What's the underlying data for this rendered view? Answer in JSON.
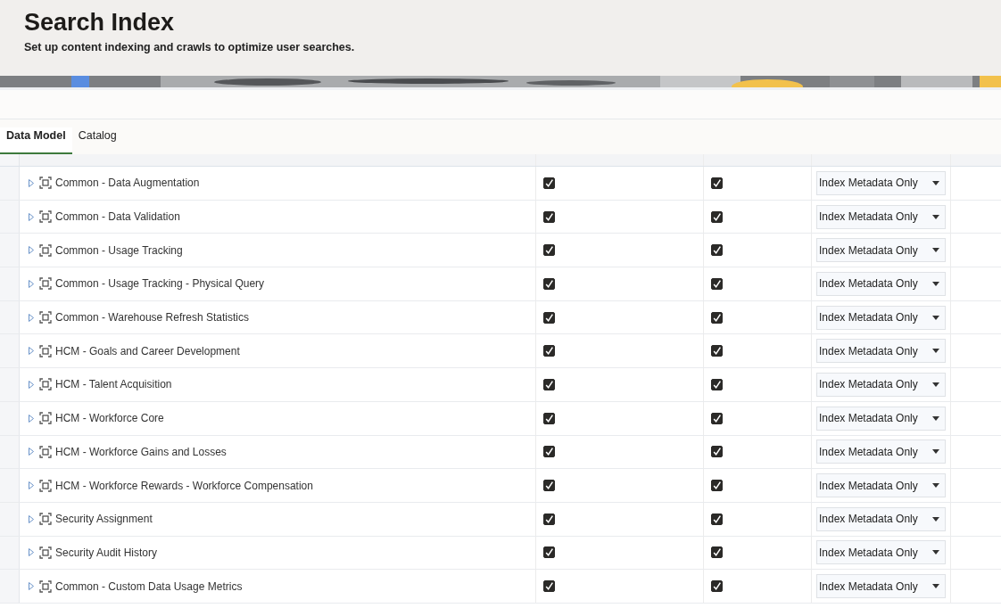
{
  "page": {
    "title": "Search Index",
    "subtitle": "Set up content indexing and crawls to optimize user searches."
  },
  "tabs": [
    {
      "label": "Data Model",
      "selected": true
    },
    {
      "label": "Catalog",
      "selected": false
    }
  ],
  "rows": [
    {
      "name": "Common - Data Augmentation",
      "assistant": true,
      "homepage_search": true,
      "crawl_status": "Index Metadata Only"
    },
    {
      "name": "Common - Data Validation",
      "assistant": true,
      "homepage_search": true,
      "crawl_status": "Index Metadata Only"
    },
    {
      "name": "Common - Usage Tracking",
      "assistant": true,
      "homepage_search": true,
      "crawl_status": "Index Metadata Only"
    },
    {
      "name": "Common - Usage Tracking - Physical Query",
      "assistant": true,
      "homepage_search": true,
      "crawl_status": "Index Metadata Only"
    },
    {
      "name": "Common - Warehouse Refresh Statistics",
      "assistant": true,
      "homepage_search": true,
      "crawl_status": "Index Metadata Only"
    },
    {
      "name": "HCM - Goals and Career Development",
      "assistant": true,
      "homepage_search": true,
      "crawl_status": "Index Metadata Only"
    },
    {
      "name": "HCM - Talent Acquisition",
      "assistant": true,
      "homepage_search": true,
      "crawl_status": "Index Metadata Only"
    },
    {
      "name": "HCM - Workforce Core",
      "assistant": true,
      "homepage_search": true,
      "crawl_status": "Index Metadata Only"
    },
    {
      "name": "HCM - Workforce Gains and Losses",
      "assistant": true,
      "homepage_search": true,
      "crawl_status": "Index Metadata Only"
    },
    {
      "name": "HCM - Workforce Rewards - Workforce Compensation",
      "assistant": true,
      "homepage_search": true,
      "crawl_status": "Index Metadata Only"
    },
    {
      "name": "Security Assignment",
      "assistant": true,
      "homepage_search": true,
      "crawl_status": "Index Metadata Only"
    },
    {
      "name": "Security Audit History",
      "assistant": true,
      "homepage_search": true,
      "crawl_status": "Index Metadata Only"
    },
    {
      "name": "Common - Custom Data Usage Metrics",
      "assistant": true,
      "homepage_search": true,
      "crawl_status": "Index Metadata Only"
    }
  ]
}
